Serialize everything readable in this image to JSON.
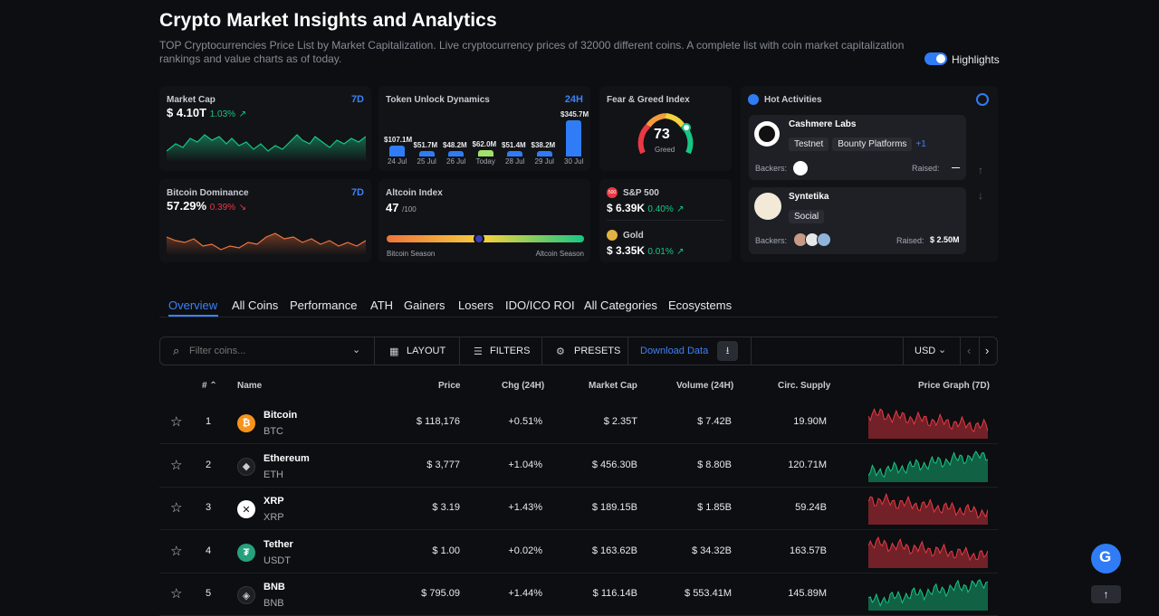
{
  "header": {
    "title": "Crypto Market Insights and Analytics",
    "subtitle": "TOP Cryptocurrencies Price List by Market Capitalization. Live cryptocurrency prices of 32000 different coins. A complete list with coin market capitalization rankings and value charts as of today.",
    "highlights_label": "Highlights",
    "highlights_on": true
  },
  "market_cap": {
    "title": "Market Cap",
    "period": "7D",
    "value": "$ 4.10T",
    "change": "1.03%",
    "change_icon": "arrow-up-right-icon"
  },
  "token_unlock": {
    "title": "Token Unlock Dynamics",
    "period": "24H",
    "bars": [
      {
        "date": "24 Jul",
        "value": "$107.1M",
        "amount": 107.1
      },
      {
        "date": "25 Jul",
        "value": "$51.7M",
        "amount": 51.7
      },
      {
        "date": "26 Jul",
        "value": "$48.2M",
        "amount": 48.2
      },
      {
        "date": "Today",
        "value": "$62.0M",
        "amount": 62.0
      },
      {
        "date": "28 Jul",
        "value": "$51.4M",
        "amount": 51.4
      },
      {
        "date": "29 Jul",
        "value": "$38.2M",
        "amount": 38.2
      },
      {
        "date": "30 Jul",
        "value": "$345.7M",
        "amount": 345.7
      }
    ]
  },
  "fear_greed": {
    "title": "Fear & Greed Index",
    "value": "73",
    "label": "Greed",
    "level": 73
  },
  "bitcoin_dominance": {
    "title": "Bitcoin Dominance",
    "period": "7D",
    "value": "57.29%",
    "change": "0.39%",
    "change_icon": "arrow-down-right-icon"
  },
  "altcoin_index": {
    "title": "Altcoin Index",
    "value": "47",
    "max": "/100",
    "level": 47,
    "left_label": "Bitcoin Season",
    "right_label": "Altcoin Season"
  },
  "sp500": {
    "label": "S&P 500",
    "value": "$ 6.39K",
    "change": "0.40%"
  },
  "gold": {
    "label": "Gold",
    "value": "$ 3.35K",
    "change": "0.01%"
  },
  "hot": {
    "title": "Hot Activities",
    "items": [
      {
        "name": "Cashmere Labs",
        "tags": [
          "Testnet",
          "Bounty Platforms"
        ],
        "extra": "+1",
        "backers_label": "Backers:",
        "raised_label": "Raised:",
        "raised": "—"
      },
      {
        "name": "Syntetika",
        "tags": [
          "Social"
        ],
        "extra": "",
        "backers_label": "Backers:",
        "raised_label": "Raised:",
        "raised": "$ 2.50M"
      }
    ]
  },
  "tabs": [
    "Overview",
    "All Coins",
    "Performance",
    "ATH",
    "Gainers",
    "Losers",
    "IDO/ICO ROI",
    "All Categories",
    "Ecosystems"
  ],
  "toolbar": {
    "filter_placeholder": "Filter coins...",
    "layout": "LAYOUT",
    "filters": "FILTERS",
    "presets": "PRESETS",
    "download": "Download Data",
    "currency": "USD"
  },
  "table": {
    "headers": {
      "rank": "#",
      "name": "Name",
      "price": "Price",
      "chg": "Chg (24H)",
      "mcap": "Market Cap",
      "vol": "Volume (24H)",
      "supply": "Circ. Supply",
      "graph": "Price Graph (7D)"
    },
    "rows": [
      {
        "rank": "1",
        "name": "Bitcoin",
        "symbol": "BTC",
        "price": "$ 118,176",
        "chg": "+0.51%",
        "mcap": "$ 2.35T",
        "vol": "$ 7.42B",
        "supply": "19.90M",
        "color": "#f7931a",
        "glyph": "₿",
        "trend": "down"
      },
      {
        "rank": "2",
        "name": "Ethereum",
        "symbol": "ETH",
        "price": "$ 3,777",
        "chg": "+1.04%",
        "mcap": "$ 456.30B",
        "vol": "$ 8.80B",
        "supply": "120.71M",
        "color": "#1e1f23",
        "glyph": "◆",
        "trend": "up"
      },
      {
        "rank": "3",
        "name": "XRP",
        "symbol": "XRP",
        "price": "$ 3.19",
        "chg": "+1.43%",
        "mcap": "$ 189.15B",
        "vol": "$ 1.85B",
        "supply": "59.24B",
        "color": "#ffffff",
        "glyph": "✕",
        "trend": "down"
      },
      {
        "rank": "4",
        "name": "Tether",
        "symbol": "USDT",
        "price": "$ 1.00",
        "chg": "+0.02%",
        "mcap": "$ 163.62B",
        "vol": "$ 34.32B",
        "supply": "163.57B",
        "color": "#26a17b",
        "glyph": "₮",
        "trend": "down"
      },
      {
        "rank": "5",
        "name": "BNB",
        "symbol": "BNB",
        "price": "$ 795.09",
        "chg": "+1.44%",
        "mcap": "$ 116.14B",
        "vol": "$ 553.41M",
        "supply": "145.89M",
        "color": "#1e1f23",
        "glyph": "◈",
        "trend": "up"
      }
    ]
  },
  "colors": {
    "accent": "#2f7cf6",
    "positive": "#16c784",
    "negative": "#ea3943"
  }
}
